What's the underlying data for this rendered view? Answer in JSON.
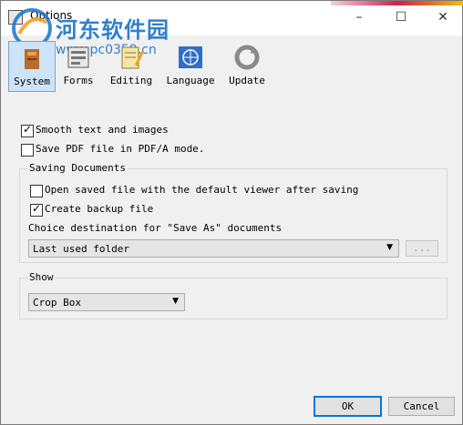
{
  "window": {
    "title": "Options"
  },
  "watermark": {
    "brand": "河东软件园",
    "url": "www.pc0359.cn"
  },
  "toolbar": {
    "tabs": [
      {
        "id": "system",
        "label": "System",
        "icon": "system-icon"
      },
      {
        "id": "forms",
        "label": "Forms",
        "icon": "forms-icon"
      },
      {
        "id": "editing",
        "label": "Editing",
        "icon": "editing-icon"
      },
      {
        "id": "language",
        "label": "Language",
        "icon": "globe-icon"
      },
      {
        "id": "update",
        "label": "Update",
        "icon": "update-icon"
      }
    ],
    "active": "system"
  },
  "options": {
    "smooth_text": {
      "label": "Smooth text and images",
      "checked": true
    },
    "pdfa": {
      "label": "Save PDF file in PDF/A mode.",
      "checked": false
    }
  },
  "saving": {
    "legend": "Saving Documents",
    "open_saved": {
      "label": "Open saved file with the default viewer after saving",
      "checked": false
    },
    "create_backup": {
      "label": "Create backup file",
      "checked": true
    },
    "destination_label": "Choice destination for \"Save As\" documents",
    "destination_value": "Last used folder",
    "browse_label": "..."
  },
  "show": {
    "legend": "Show",
    "box_value": "Crop Box"
  },
  "buttons": {
    "ok": "OK",
    "cancel": "Cancel"
  },
  "colors": {
    "accent": "#0078d7",
    "active_tab": "#cde3f7",
    "watermark": "#1a73c8"
  }
}
